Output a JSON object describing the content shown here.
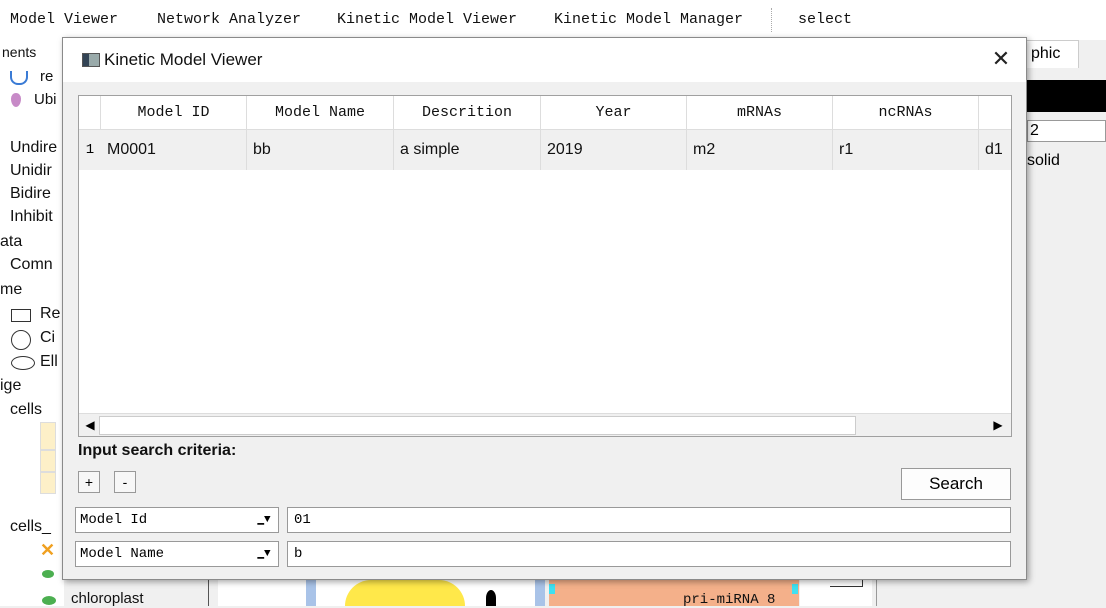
{
  "menubar": {
    "items": [
      "Model Viewer",
      "Network Analyzer",
      "Kinetic Model Viewer",
      "Kinetic Model Manager",
      "select"
    ]
  },
  "left_panel": {
    "tab_label": "nents",
    "items": [
      "re",
      "Ubi",
      "Undire",
      "Unidir",
      "Bidire",
      "Inhibit",
      "ata",
      "Comn",
      "me",
      "Re",
      "Ci",
      "Ell",
      "ige",
      "cells",
      "cells_",
      "chloroplast"
    ]
  },
  "right_panel": {
    "tab_label": "phic",
    "value1": "2",
    "value2": "solid"
  },
  "canvas": {
    "label": "pri-miRNA 8"
  },
  "dialog": {
    "title": "Kinetic Model Viewer",
    "close_glyph": "✕",
    "table": {
      "columns": [
        "Model ID",
        "Model Name",
        "Descrition",
        "Year",
        "mRNAs",
        "ncRNAs",
        ""
      ],
      "rows": [
        {
          "num": "1",
          "cells": [
            "M0001",
            "bb",
            "a simple",
            "2019",
            "m2",
            "r1",
            "d1"
          ]
        }
      ]
    },
    "search": {
      "label": "Input search criteria:",
      "add_label": "+",
      "remove_label": "-",
      "button_label": "Search",
      "criteria": [
        {
          "field": "Model Id",
          "value": "01"
        },
        {
          "field": "Model Name",
          "value": "b"
        }
      ]
    }
  },
  "colors": {
    "canvas_orange": "#f4b08a",
    "canvas_yellow": "#ffe84a",
    "canvas_blue": "#a9c3e8",
    "canvas_cyan": "#3fe0f0",
    "icon_green": "#4caf50",
    "icon_orange": "#f0a020"
  }
}
